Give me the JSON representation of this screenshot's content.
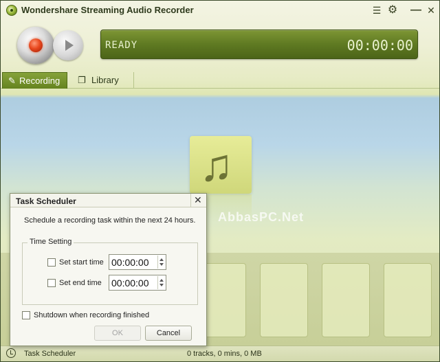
{
  "app": {
    "title": "Wondershare Streaming Audio Recorder",
    "titlebar_icons": [
      "list-icon",
      "gear-icon",
      "minimize-icon",
      "close-icon"
    ]
  },
  "display": {
    "status": "READY",
    "timer": "00:00:00"
  },
  "tabs": [
    {
      "label": "Recording",
      "icon": "pencil-icon",
      "active": true
    },
    {
      "label": "Library",
      "icon": "library-icon",
      "active": false
    }
  ],
  "watermark": "AbbasPC.Net",
  "dialog": {
    "title": "Task Scheduler",
    "description": "Schedule a recording task within the next 24 hours.",
    "time_setting_label": "Time Setting",
    "start": {
      "label": "Set start time",
      "checked": false,
      "value": "00:00:00"
    },
    "end": {
      "label": "Set end time",
      "checked": false,
      "value": "00:00:00"
    },
    "shutdown": {
      "label": "Shutdown when recording finished",
      "checked": false
    },
    "ok_label": "OK",
    "cancel_label": "Cancel",
    "close_glyph": "✕"
  },
  "statusbar": {
    "task_label": "Task Scheduler",
    "stats": "0 tracks, 0 mins, 0 MB"
  },
  "colors": {
    "display_green": "#5f7a22",
    "active_tab": "#65831f",
    "record_red": "#e8481e"
  }
}
